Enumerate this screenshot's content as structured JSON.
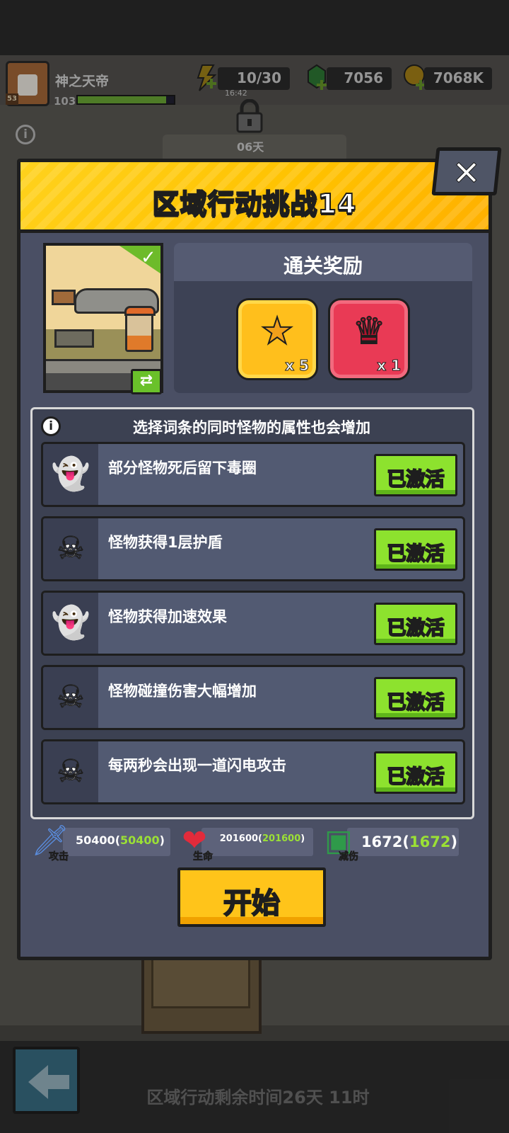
{
  "hud": {
    "player_name": "神之天帝",
    "player_level": "53",
    "power": "103",
    "energy": "10/30",
    "energy_timer": "16:42",
    "gems": "7056",
    "gold": "7068K"
  },
  "background": {
    "lock_label": "06天",
    "remaining_time": "区域行动剩余时间26天 11时"
  },
  "dialog": {
    "title": "区域行动挑战14",
    "close_glyph": "✕",
    "rewards_title": "通关奖励",
    "rewards": [
      {
        "icon": "star-medal-icon",
        "quantity": "x 5"
      },
      {
        "icon": "crown-badge-icon",
        "quantity": "x 1"
      }
    ],
    "modifiers_header": "选择词条的同时怪物的属性也会增加",
    "modifiers": [
      {
        "icon": "ghost-speed-icon",
        "text": "部分怪物死后留下毒圈",
        "button": "已激活"
      },
      {
        "icon": "skull-icon",
        "text": "怪物获得1层护盾",
        "button": "已激活"
      },
      {
        "icon": "ghost-speed-icon",
        "text": "怪物获得加速效果",
        "button": "已激活"
      },
      {
        "icon": "skull-icon",
        "text": "怪物碰撞伤害大幅增加",
        "button": "已激活"
      },
      {
        "icon": "skull-icon",
        "text": "每两秒会出现一道闪电攻击",
        "button": "已激活"
      }
    ],
    "stats": {
      "attack": {
        "label": "攻击",
        "value": "50400",
        "bonus": "50400"
      },
      "health": {
        "label": "生命",
        "value": "201600",
        "bonus": "201600"
      },
      "defense": {
        "label": "减伤",
        "value": "1672",
        "bonus": "1672"
      }
    },
    "start_button": "开始"
  },
  "colors": {
    "header_yellow": "#ffc200",
    "activate_green": "#8de22e",
    "start_yellow": "#ffc41a",
    "panel_dark": "#4a4f64",
    "bonus_green": "#9be035"
  }
}
